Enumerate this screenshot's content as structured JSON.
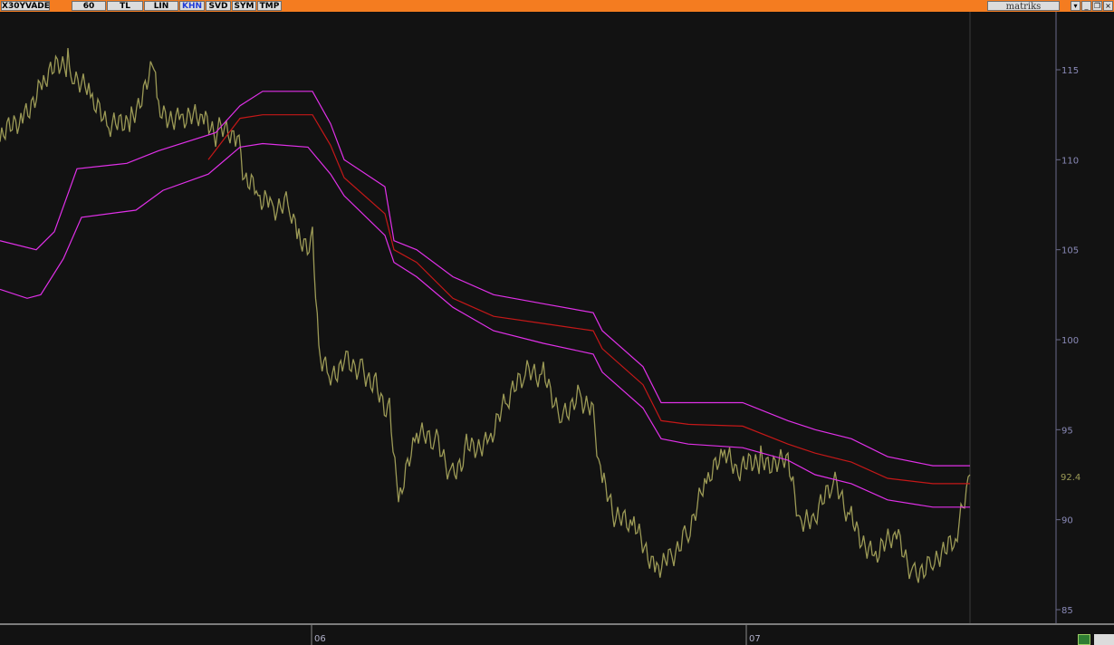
{
  "toolbar": {
    "symbol": "X30YVADE",
    "buttons": [
      "60",
      "TL",
      "LIN",
      "KHN",
      "SVD",
      "SYM",
      "TMP"
    ],
    "active_button": "KHN",
    "brand": "matriks"
  },
  "colors": {
    "background": "#121212",
    "price": "#9c9a56",
    "band_outer": "#e030e8",
    "band_mid": "#c41818",
    "axis_text": "#8a8ab8",
    "last_price_text": "#9c9a56"
  },
  "chart_data": {
    "type": "line",
    "title": "",
    "ylim": [
      84,
      118
    ],
    "y_ticks": [
      85,
      90,
      95,
      100,
      105,
      110,
      115
    ],
    "x_ticks": [
      "06",
      "07"
    ],
    "last_price_label": "92.4",
    "series": [
      {
        "role": "price",
        "x": [
          0,
          25,
          50,
          75,
          80,
          100,
          120,
          145,
          170,
          175,
          200,
          225,
          240,
          262,
          270,
          285,
          300,
          320,
          330,
          345,
          352,
          365,
          380,
          400,
          415,
          430,
          440,
          460,
          480,
          500,
          515,
          540,
          560,
          580,
          600,
          620,
          640,
          655,
          665,
          680,
          700,
          725,
          740,
          760,
          780,
          800,
          815,
          840,
          870,
          885,
          900,
          920,
          940,
          965,
          990,
          1010,
          1030,
          1055,
          1071
        ],
        "values": [
          111,
          112.5,
          114.5,
          115.5,
          115,
          113.5,
          111.5,
          112.5,
          115,
          112.5,
          112.5,
          112,
          111.5,
          111.5,
          109,
          108,
          107.5,
          107.5,
          105.5,
          105.5,
          99.5,
          98,
          99,
          98.5,
          97.5,
          96,
          91,
          94.5,
          94.5,
          92.5,
          94,
          94.5,
          96.5,
          98,
          98,
          96,
          97,
          96,
          92,
          90,
          89.5,
          87.5,
          88,
          89.5,
          92,
          93.5,
          92.5,
          93.5,
          93,
          89.5,
          90,
          92,
          90,
          88,
          89,
          87,
          88,
          88.5,
          92.5
        ]
      },
      {
        "role": "band_upper",
        "x": [
          0,
          40,
          60,
          85,
          140,
          175,
          238,
          265,
          290,
          345,
          365,
          380,
          425,
          435,
          460,
          500,
          545,
          600,
          655,
          665,
          710,
          730,
          760,
          820,
          870,
          900,
          940,
          980,
          1030,
          1071
        ],
        "values": [
          105.5,
          105,
          106,
          109.5,
          109.8,
          110.5,
          111.5,
          113,
          113.8,
          113.8,
          112,
          110,
          108.5,
          105.5,
          105,
          103.5,
          102.5,
          102,
          101.5,
          100.5,
          98.5,
          96.5,
          96.5,
          96.5,
          95.5,
          95,
          94.5,
          93.5,
          93,
          93
        ]
      },
      {
        "role": "band_mid",
        "x": [
          230,
          265,
          290,
          345,
          365,
          380,
          425,
          435,
          460,
          500,
          545,
          600,
          655,
          665,
          710,
          730,
          760,
          820,
          870,
          900,
          940,
          980,
          1030,
          1071
        ],
        "values": [
          110,
          112.3,
          112.5,
          112.5,
          110.8,
          109,
          107,
          105,
          104.3,
          102.3,
          101.3,
          100.9,
          100.5,
          99.5,
          97.5,
          95.5,
          95.3,
          95.2,
          94.2,
          93.7,
          93.2,
          92.3,
          92,
          92
        ]
      },
      {
        "role": "band_lower",
        "x": [
          0,
          30,
          45,
          70,
          90,
          150,
          180,
          230,
          265,
          290,
          340,
          365,
          380,
          425,
          435,
          460,
          500,
          545,
          600,
          655,
          665,
          710,
          730,
          760,
          820,
          870,
          900,
          940,
          980,
          1030,
          1071
        ],
        "values": [
          102.8,
          102.3,
          102.5,
          104.5,
          106.8,
          107.2,
          108.3,
          109.2,
          110.7,
          110.9,
          110.7,
          109.2,
          108,
          105.8,
          104.3,
          103.5,
          101.8,
          100.5,
          99.8,
          99.2,
          98.2,
          96.2,
          94.5,
          94.2,
          94,
          93.3,
          92.5,
          92,
          91.1,
          90.7,
          90.7
        ]
      }
    ]
  }
}
